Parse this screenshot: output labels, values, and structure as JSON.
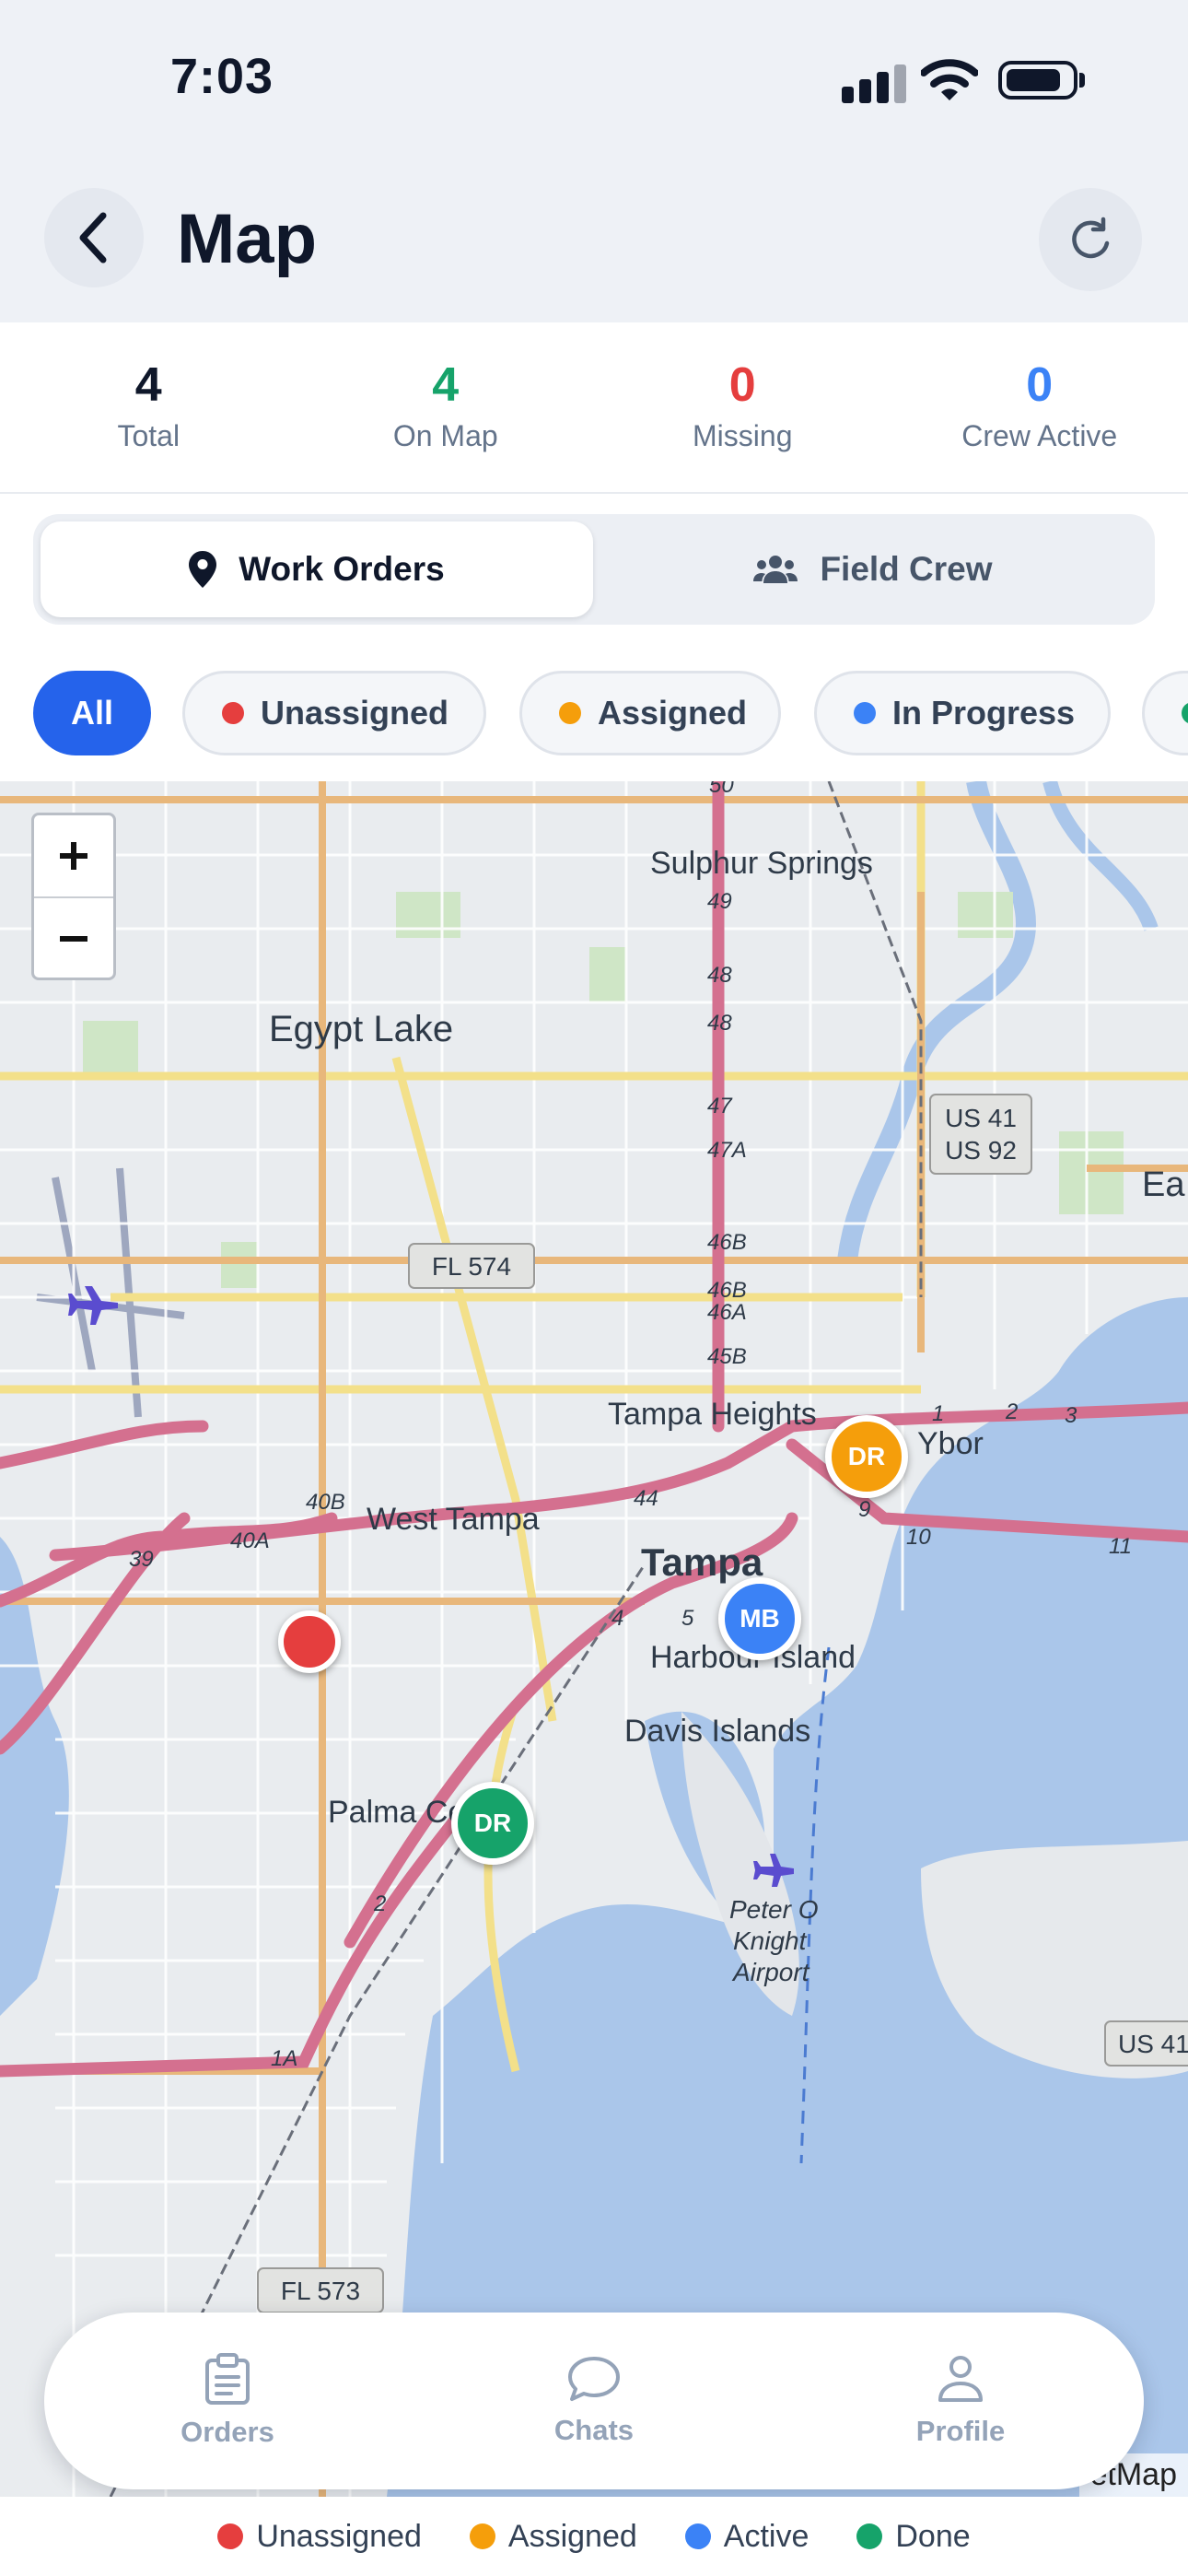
{
  "status_bar": {
    "time": "7:03"
  },
  "header": {
    "title": "Map"
  },
  "stats": [
    {
      "value": "4",
      "label": "Total",
      "color": "#0f172a"
    },
    {
      "value": "4",
      "label": "On Map",
      "color": "#16a36a"
    },
    {
      "value": "0",
      "label": "Missing",
      "color": "#e53e3e"
    },
    {
      "value": "0",
      "label": "Crew Active",
      "color": "#3b82f6"
    }
  ],
  "segmented": {
    "work_orders": "Work Orders",
    "field_crew": "Field Crew",
    "selected": "Work Orders"
  },
  "filters": {
    "all": "All",
    "unassigned": "Unassigned",
    "assigned": "Assigned",
    "in_progress": "In Progress"
  },
  "colors": {
    "unassigned": "#e53e3e",
    "assigned": "#f59e0b",
    "active": "#3b82f6",
    "done": "#16a36a",
    "accent": "#2563eb"
  },
  "map": {
    "labels": {
      "sulphur_springs": "Sulphur Springs",
      "egypt_lake": "Egypt Lake",
      "us41": "US 41",
      "us92": "US 92",
      "fl574": "FL 574",
      "tampa_heights": "Tampa Heights",
      "ybor": "Ybor",
      "west_tampa": "West Tampa",
      "tampa": "Tampa",
      "harbour_island": "Harbour Island",
      "davis_islands": "Davis Islands",
      "palma_ceia": "Palma Ce",
      "peter_o": "Peter O",
      "knight": "Knight",
      "airport": "Airport",
      "fl573": "FL 573",
      "us41_east": "US 41",
      "ea": "Ea",
      "attribution": "etMap"
    },
    "exit_numbers": [
      "50",
      "49",
      "48",
      "48",
      "47",
      "47A",
      "46B",
      "46B",
      "46A",
      "45B",
      "44",
      "40B",
      "40A",
      "39",
      "9",
      "10",
      "11",
      "1",
      "2",
      "3",
      "4",
      "5",
      "2",
      "1A"
    ],
    "markers": [
      {
        "initials": "DR",
        "status": "assigned"
      },
      {
        "initials": "MB",
        "status": "active"
      },
      {
        "initials": "",
        "status": "unassigned"
      },
      {
        "initials": "DR",
        "status": "done"
      }
    ]
  },
  "tabbar": {
    "orders": "Orders",
    "chats": "Chats",
    "profile": "Profile"
  },
  "legend": {
    "unassigned": "Unassigned",
    "assigned": "Assigned",
    "active": "Active",
    "done": "Done"
  }
}
